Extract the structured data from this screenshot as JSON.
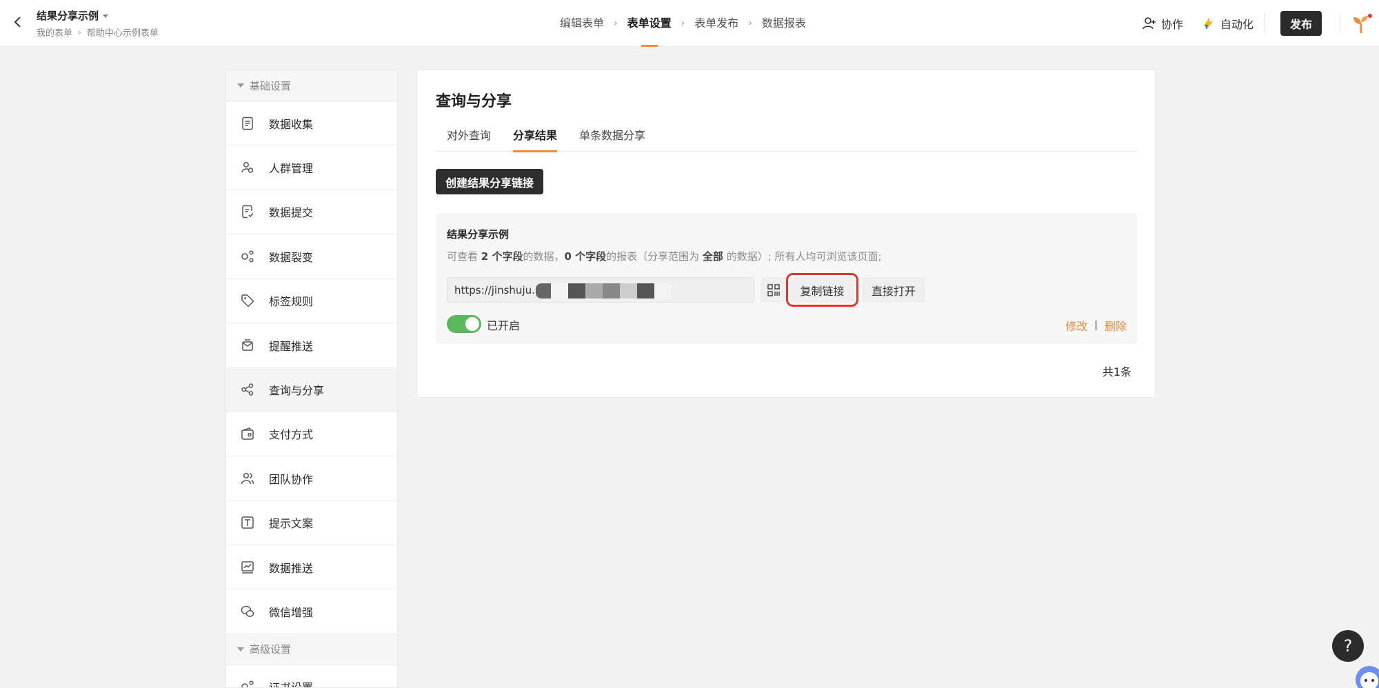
{
  "header": {
    "form_title": "结果分享示例",
    "breadcrumb": [
      "我的表单",
      "帮助中心示例表单"
    ],
    "steps": [
      {
        "label": "编辑表单",
        "active": false
      },
      {
        "label": "表单设置",
        "active": true
      },
      {
        "label": "表单发布",
        "active": false
      },
      {
        "label": "数据报表",
        "active": false
      }
    ],
    "collab_label": "协作",
    "automation_label": "自动化",
    "publish_label": "发布"
  },
  "sidebar": {
    "basic_section": "基础设置",
    "items": [
      {
        "label": "数据收集",
        "icon": "document-icon"
      },
      {
        "label": "人群管理",
        "icon": "user-group-icon"
      },
      {
        "label": "数据提交",
        "icon": "submit-icon"
      },
      {
        "label": "数据裂变",
        "icon": "fission-icon"
      },
      {
        "label": "标签规则",
        "icon": "tag-icon"
      },
      {
        "label": "提醒推送",
        "icon": "notify-icon"
      },
      {
        "label": "查询与分享",
        "icon": "share-icon",
        "active": true
      },
      {
        "label": "支付方式",
        "icon": "wallet-icon"
      },
      {
        "label": "团队协作",
        "icon": "team-icon"
      },
      {
        "label": "提示文案",
        "icon": "text-icon"
      },
      {
        "label": "数据推送",
        "icon": "chart-icon"
      },
      {
        "label": "微信增强",
        "icon": "wechat-icon"
      }
    ],
    "advanced_section": "高级设置",
    "advanced_items": [
      {
        "label": "证书设置",
        "icon": "certificate-icon"
      }
    ]
  },
  "main": {
    "title": "查询与分享",
    "tabs": [
      {
        "label": "对外查询",
        "active": false
      },
      {
        "label": "分享结果",
        "active": true
      },
      {
        "label": "单条数据分享",
        "active": false
      }
    ],
    "create_button": "创建结果分享链接",
    "share": {
      "name": "结果分享示例",
      "desc_prefix": "可查看 ",
      "desc_count1": "2 个字段",
      "desc_mid1": "的数据，",
      "desc_count2": "0 个字段",
      "desc_mid2": "的报表（分享范围为 ",
      "desc_scope": "全部",
      "desc_suffix": " 的数据）; 所有人均可浏览该页面;",
      "url": "https://jinshuju.",
      "copy_label": "复制链接",
      "open_label": "直接打开",
      "toggle_label": "已开启",
      "toggle_on": true,
      "edit_label": "修改",
      "delete_label": "删除"
    },
    "total_label": "共1条"
  },
  "help_label": "?",
  "colors": {
    "accent": "#f08b3a",
    "toggle_on": "#5cb85c",
    "highlight": "#d93a2a",
    "dark_button": "#2d2d2d"
  }
}
